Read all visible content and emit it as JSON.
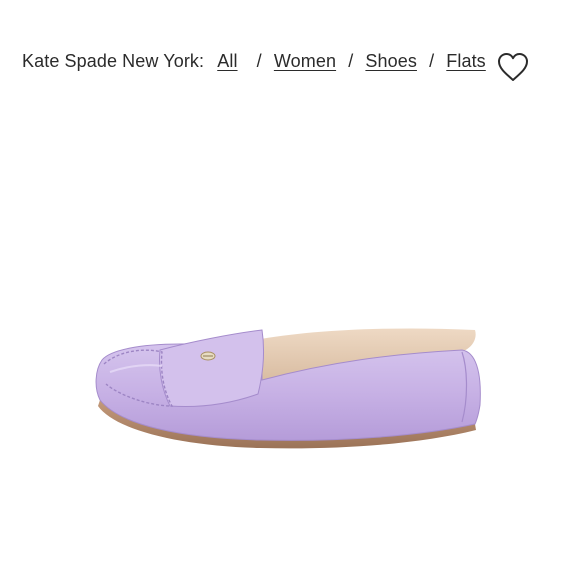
{
  "breadcrumb": {
    "brand": "Kate Spade New York:",
    "items": [
      {
        "label": "All"
      },
      {
        "label": "Women"
      },
      {
        "label": "Shoes"
      },
      {
        "label": "Flats"
      }
    ],
    "separator": "/"
  },
  "product": {
    "image": "lavender-leather-loafer",
    "color": "#c9b4e6"
  },
  "icons": {
    "favorite": "heart-outline-icon"
  }
}
